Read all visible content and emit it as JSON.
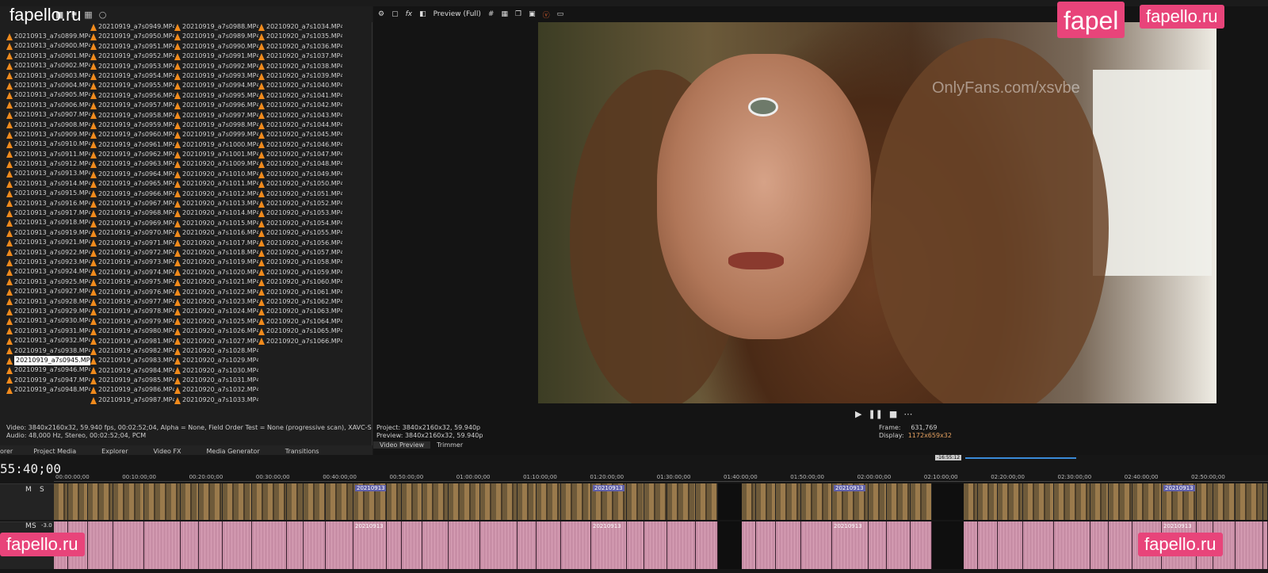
{
  "watermarks": {
    "top_left": "fapello.ru",
    "top_right_a": "fapel",
    "top_right_b": "fapello.ru",
    "bottom_left": "fapello.ru",
    "bottom_right": "fapello.ru",
    "onlyfans": "OnlyFans.com/xsvbe"
  },
  "files": {
    "col1": [
      "20210913_a7s0899.MP4",
      "20210913_a7s0900.MP4",
      "20210913_a7s0901.MP4",
      "20210913_a7s0902.MP4",
      "20210913_a7s0903.MP4",
      "20210913_a7s0904.MP4",
      "20210913_a7s0905.MP4",
      "20210913_a7s0906.MP4",
      "20210913_a7s0907.MP4",
      "20210913_a7s0908.MP4",
      "20210913_a7s0909.MP4",
      "20210913_a7s0910.MP4",
      "20210913_a7s0911.MP4",
      "20210913_a7s0912.MP4",
      "20210913_a7s0913.MP4",
      "20210913_a7s0914.MP4",
      "20210913_a7s0915.MP4",
      "20210913_a7s0916.MP4",
      "20210913_a7s0917.MP4",
      "20210913_a7s0918.MP4",
      "20210913_a7s0919.MP4",
      "20210913_a7s0921.MP4",
      "20210913_a7s0922.MP4",
      "20210913_a7s0923.MP4",
      "20210913_a7s0924.MP4",
      "20210913_a7s0925.MP4",
      "20210913_a7s0927.MP4",
      "20210913_a7s0928.MP4",
      "20210913_a7s0929.MP4",
      "20210913_a7s0930.MP4",
      "20210913_a7s0931.MP4",
      "20210913_a7s0932.MP4",
      "20210919_a7s0938.MP4",
      "20210919_a7s0945.MP4",
      "20210919_a7s0946.MP4",
      "20210919_a7s0947.MP4",
      "20210919_a7s0948.MP4"
    ],
    "col2": [
      "20210919_a7s0949.MP4",
      "20210919_a7s0950.MP4",
      "20210919_a7s0951.MP4",
      "20210919_a7s0952.MP4",
      "20210919_a7s0953.MP4",
      "20210919_a7s0954.MP4",
      "20210919_a7s0955.MP4",
      "20210919_a7s0956.MP4",
      "20210919_a7s0957.MP4",
      "20210919_a7s0958.MP4",
      "20210919_a7s0959.MP4",
      "20210919_a7s0960.MP4",
      "20210919_a7s0961.MP4",
      "20210919_a7s0962.MP4",
      "20210919_a7s0963.MP4",
      "20210919_a7s0964.MP4",
      "20210919_a7s0965.MP4",
      "20210919_a7s0966.MP4",
      "20210919_a7s0967.MP4",
      "20210919_a7s0968.MP4",
      "20210919_a7s0969.MP4",
      "20210919_a7s0970.MP4",
      "20210919_a7s0971.MP4",
      "20210919_a7s0972.MP4",
      "20210919_a7s0973.MP4",
      "20210919_a7s0974.MP4",
      "20210919_a7s0975.MP4",
      "20210919_a7s0976.MP4",
      "20210919_a7s0977.MP4",
      "20210919_a7s0978.MP4",
      "20210919_a7s0979.MP4",
      "20210919_a7s0980.MP4",
      "20210919_a7s0981.MP4",
      "20210919_a7s0982.MP4",
      "20210919_a7s0983.MP4",
      "20210919_a7s0984.MP4",
      "20210919_a7s0985.MP4",
      "20210919_a7s0986.MP4",
      "20210919_a7s0987.MP4"
    ],
    "col3": [
      "20210919_a7s0988.MP4",
      "20210919_a7s0989.MP4",
      "20210919_a7s0990.MP4",
      "20210919_a7s0991.MP4",
      "20210919_a7s0992.MP4",
      "20210919_a7s0993.MP4",
      "20210919_a7s0994.MP4",
      "20210919_a7s0995.MP4",
      "20210919_a7s0996.MP4",
      "20210919_a7s0997.MP4",
      "20210919_a7s0998.MP4",
      "20210919_a7s0999.MP4",
      "20210919_a7s1000.MP4",
      "20210919_a7s1001.MP4",
      "20210920_a7s1009.MP4",
      "20210920_a7s1010.MP4",
      "20210920_a7s1011.MP4",
      "20210920_a7s1012.MP4",
      "20210920_a7s1013.MP4",
      "20210920_a7s1014.MP4",
      "20210920_a7s1015.MP4",
      "20210920_a7s1016.MP4",
      "20210920_a7s1017.MP4",
      "20210920_a7s1018.MP4",
      "20210920_a7s1019.MP4",
      "20210920_a7s1020.MP4",
      "20210920_a7s1021.MP4",
      "20210920_a7s1022.MP4",
      "20210920_a7s1023.MP4",
      "20210920_a7s1024.MP4",
      "20210920_a7s1025.MP4",
      "20210920_a7s1026.MP4",
      "20210920_a7s1027.MP4",
      "20210920_a7s1028.MP4",
      "20210920_a7s1029.MP4",
      "20210920_a7s1030.MP4",
      "20210920_a7s1031.MP4",
      "20210920_a7s1032.MP4",
      "20210920_a7s1033.MP4"
    ],
    "col4": [
      "20210920_a7s1034.MP4",
      "20210920_a7s1035.MP4",
      "20210920_a7s1036.MP4",
      "20210920_a7s1037.MP4",
      "20210920_a7s1038.MP4",
      "20210920_a7s1039.MP4",
      "20210920_a7s1040.MP4",
      "20210920_a7s1041.MP4",
      "20210920_a7s1042.MP4",
      "20210920_a7s1043.MP4",
      "20210920_a7s1044.MP4",
      "20210920_a7s1045.MP4",
      "20210920_a7s1046.MP4",
      "20210920_a7s1047.MP4",
      "20210920_a7s1048.MP4",
      "20210920_a7s1049.MP4",
      "20210920_a7s1050.MP4",
      "20210920_a7s1051.MP4",
      "20210920_a7s1052.MP4",
      "20210920_a7s1053.MP4",
      "20210920_a7s1054.MP4",
      "20210920_a7s1055.MP4",
      "20210920_a7s1056.MP4",
      "20210920_a7s1057.MP4",
      "20210920_a7s1058.MP4",
      "20210920_a7s1059.MP4",
      "20210920_a7s1060.MP4",
      "20210920_a7s1061.MP4",
      "20210920_a7s1062.MP4",
      "20210920_a7s1063.MP4",
      "20210920_a7s1064.MP4",
      "20210920_a7s1065.MP4",
      "20210920_a7s1066.MP4"
    ],
    "selected": "20210919_a7s0945.MP4"
  },
  "left_info": {
    "video": "Video: 3840x2160x32, 59.940 fps, 00:02:52;04, Alpha = None, Field Order Test = None (progressive scan), XAVC-S",
    "audio": "Audio: 48,000 Hz, Stereo, 00:02:52;04, PCM"
  },
  "left_tabs": [
    "orer",
    "Project Media",
    "Explorer",
    "Video FX",
    "Media Generator",
    "Transitions"
  ],
  "preview": {
    "mode": "Preview (Full)",
    "project": "Project:  3840x2160x32, 59.940p",
    "preview": "Preview: 3840x2160x32, 59.940p",
    "frame_label": "Frame:",
    "frame_value": "631,769",
    "display_label": "Display:",
    "display_value": "1172x659x32"
  },
  "right_tabs": [
    "Video Preview",
    "Trimmer"
  ],
  "timeline": {
    "timecode": "55:40;00",
    "cursor": "-16:55:12",
    "ruler": [
      "00:00:00;00",
      "00:10:00;00",
      "00:20:00;00",
      "00:30:00;00",
      "00:40:00;00",
      "00:50:00;00",
      "01:00:00;00",
      "01:10:00;00",
      "01:20:00;00",
      "01:30:00;00",
      "01:40:00;00",
      "01:50:00;00",
      "02:00:00;00",
      "02:10:00;00",
      "02:20:00;00",
      "02:30:00;00",
      "02:40:00;00",
      "02:50:00;00"
    ],
    "track_m": "M",
    "track_s": "S",
    "level": "-3.0",
    "clip_label": "20210913",
    "fx_label": "fx"
  }
}
